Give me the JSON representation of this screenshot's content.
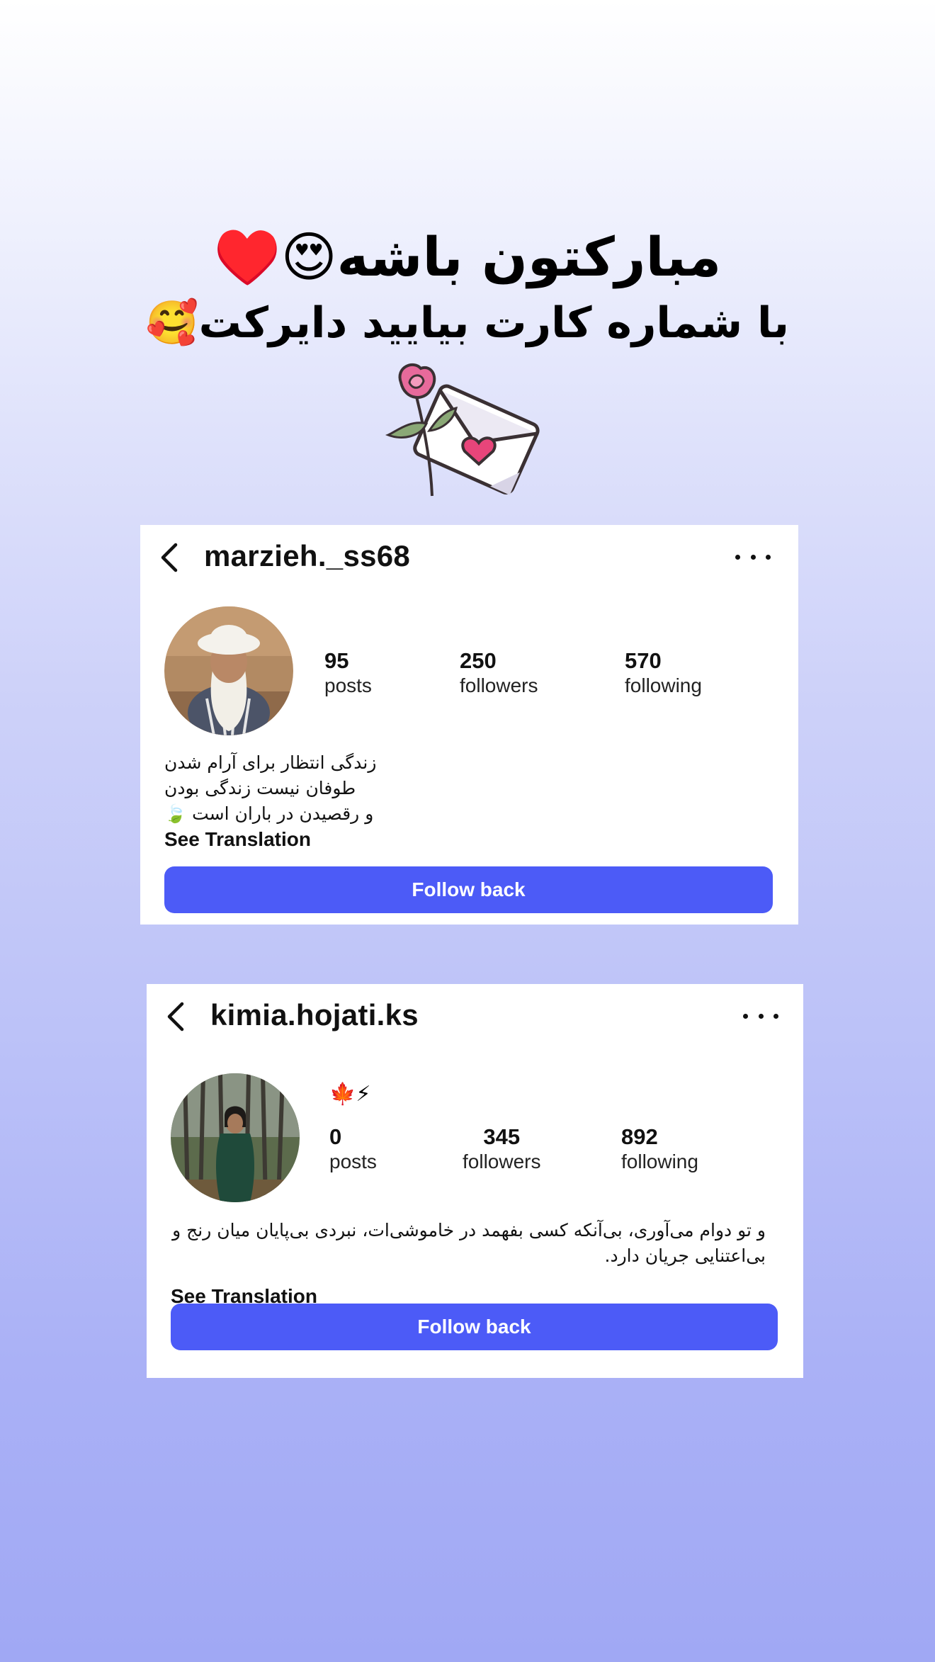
{
  "headline": {
    "line1": "مبارکتون باشه😍♥️",
    "line2": "با شماره کارت بیایید دایرکت🥰"
  },
  "colors": {
    "accent": "#4c5bf7",
    "background_top": "#ffffff",
    "background_bottom": "#a0a8f4"
  },
  "profiles": [
    {
      "username": "marzieh._ss68",
      "posts": "95",
      "posts_label": "posts",
      "followers": "250",
      "followers_label": "followers",
      "following": "570",
      "following_label": "following",
      "bio": [
        "زندگی انتظار برای آرام شدن",
        "طوفان نیست زندگی بودن",
        "و رقصیدن در باران است 🍃"
      ],
      "see_translation": "See Translation",
      "follow_label": "Follow back"
    },
    {
      "username": "kimia.hojati.ks",
      "status_emojis": "🍁⚡",
      "posts": "0",
      "posts_label": "posts",
      "followers": "345",
      "followers_label": "followers",
      "following": "892",
      "following_label": "following",
      "bio": [
        "و تو دوام می‌آوری، بی‌آنکه کسی بفهمد در خاموشی‌ات، نبردی بی‌پایان میان رنج و",
        "بی‌اعتنایی جریان دارد."
      ],
      "see_translation": "See Translation",
      "follow_label": "Follow back"
    }
  ],
  "icons": [
    "back-arrow-icon",
    "more-options-icon",
    "rose-envelope-sticker"
  ]
}
